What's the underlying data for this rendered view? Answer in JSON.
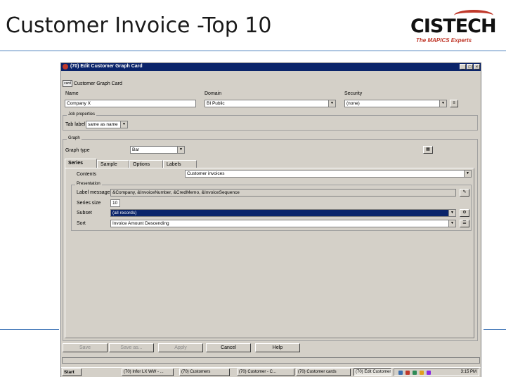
{
  "slide": {
    "title": "Customer Invoice -Top 10",
    "logo_text": "CISTECH",
    "logo_tagline": "The MAPICS Experts"
  },
  "window": {
    "title": "(70) Edit Customer Graph Card",
    "minimize": "_",
    "maximize": "□",
    "close": "×",
    "header_icon": "card",
    "header_label": "Customer Graph Card",
    "name_label": "Name",
    "name_value": "Company X",
    "domain_label": "Domain",
    "domain_value": "BI Public",
    "security_label": "Security",
    "security_value": "(none)",
    "properties_group": "Job properties",
    "tab_label_label": "Tab label",
    "tab_label_value": "same as name",
    "graph_group": "Graph",
    "graph_type_label": "Graph type",
    "graph_type_value": "Bar",
    "tabs": [
      "Series",
      "Sample",
      "Options",
      "Labels"
    ],
    "contents_label": "Contents",
    "contents_value": "Customer invoices",
    "presentation_group": "Presentation",
    "label_message_label": "Label message",
    "label_message_value": "&Company, &InvoiceNumber, &CredMemo, &InvoiceSequence",
    "series_size_label": "Series size",
    "series_size_value": "10",
    "subset_label": "Subset",
    "subset_value": "(all records)",
    "sort_label": "Sort",
    "sort_value": "Invoice Amount Descending",
    "buttons": [
      "Save",
      "Save as...",
      "Apply",
      "Cancel",
      "Help"
    ]
  },
  "taskbar": {
    "start": "Start",
    "tasks": [
      "(70) Infor LX WW - ...",
      "(70) Customers",
      "(70) Customer - C...",
      "(70) Customer cards",
      "(70) Edit Customers..."
    ],
    "clock": "3:15 PM"
  }
}
